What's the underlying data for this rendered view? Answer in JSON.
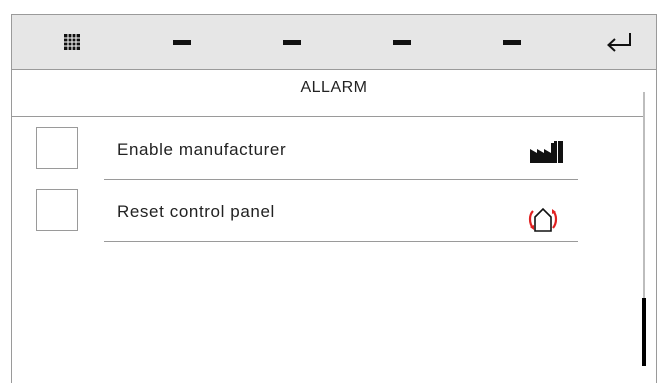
{
  "toolbar": {
    "items": [
      {
        "icon": "grid-icon"
      },
      {
        "icon": "dash-icon"
      },
      {
        "icon": "dash-icon"
      },
      {
        "icon": "dash-icon"
      },
      {
        "icon": "dash-icon"
      },
      {
        "icon": "return-icon"
      }
    ]
  },
  "screen": {
    "title": "ALLARM"
  },
  "rows": [
    {
      "label": "Enable manufacturer",
      "icon": "factory-icon",
      "checked": false
    },
    {
      "label": "Reset control panel",
      "icon": "home-reset-icon",
      "checked": false
    }
  ],
  "colors": {
    "toolbar_bg": "#e6e6e6",
    "border": "#9a9a9a",
    "icon_dark": "#111111",
    "reset_arrows": "#e02020"
  }
}
